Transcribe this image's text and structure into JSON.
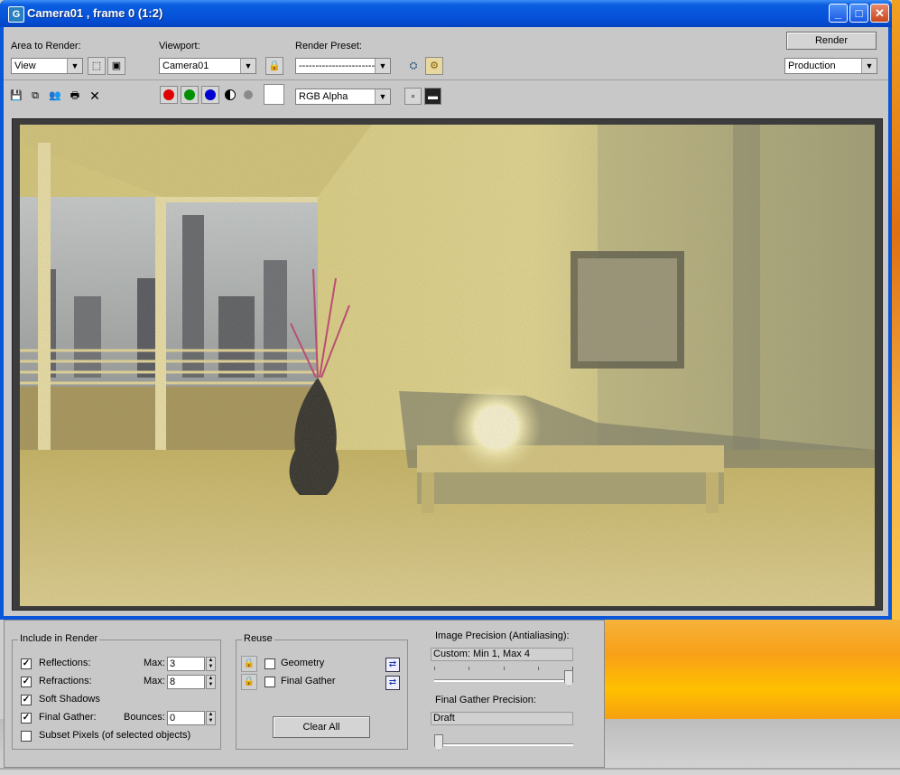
{
  "window": {
    "title": "Camera01 , frame 0 (1:2)"
  },
  "toolbar1": {
    "area_label": "Area to Render:",
    "area_value": "View",
    "viewport_label": "Viewport:",
    "viewport_value": "Camera01",
    "preset_label": "Render Preset:",
    "preset_value": "--------------------------",
    "render_button": "Render",
    "mode_value": "Production"
  },
  "toolbar2": {
    "channel_value": "RGB Alpha"
  },
  "include": {
    "title": "Include in Render",
    "reflections": {
      "label": "Reflections:",
      "checked": true,
      "max_label": "Max:",
      "max": "3"
    },
    "refractions": {
      "label": "Refractions:",
      "checked": true,
      "max_label": "Max:",
      "max": "8"
    },
    "soft_shadows": {
      "label": "Soft Shadows",
      "checked": true
    },
    "final_gather": {
      "label": "Final Gather:",
      "checked": true,
      "bounces_label": "Bounces:",
      "bounces": "0"
    },
    "subset_pixels": {
      "label": "Subset Pixels (of selected objects)",
      "checked": false
    }
  },
  "reuse": {
    "title": "Reuse",
    "geometry": "Geometry",
    "final_gather": "Final Gather",
    "clear_all": "Clear All"
  },
  "precision": {
    "image_label": "Image Precision (Antialiasing):",
    "image_value": "Custom: Min 1, Max 4",
    "image_level": 1.0,
    "fg_label": "Final Gather Precision:",
    "fg_value": "Draft",
    "fg_level": 0.0
  },
  "colors": {
    "title_bar": "#0550d8",
    "window_bg": "#c8c8c8",
    "accent_orange": "#f8a018"
  }
}
